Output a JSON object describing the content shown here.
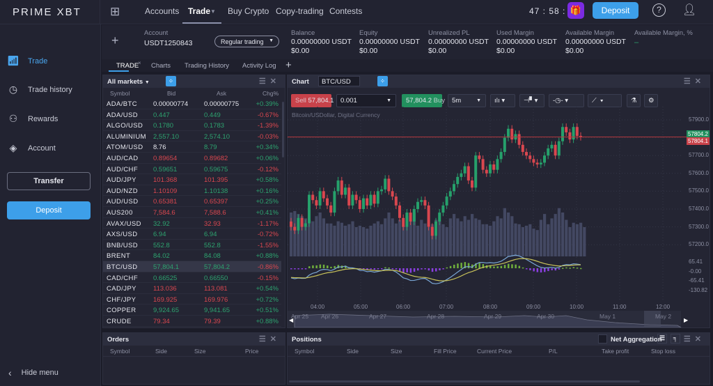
{
  "header": {
    "logo": "PRIME XBT",
    "nav": [
      "Accounts",
      "Trade",
      "Buy Crypto",
      "Copy-trading",
      "Contests"
    ],
    "timer": "47 : 58 : 47",
    "deposit": "Deposit"
  },
  "sidebar": {
    "items": [
      {
        "label": "Trade",
        "icon": "bar-chart-icon"
      },
      {
        "label": "Trade history",
        "icon": "clock-icon"
      },
      {
        "label": "Rewards",
        "icon": "people-icon"
      },
      {
        "label": "Account",
        "icon": "layers-icon"
      }
    ],
    "transfer": "Transfer",
    "deposit": "Deposit",
    "hide_menu": "Hide menu"
  },
  "account": {
    "label": "Account",
    "id": "USDT1250843",
    "mode": "Regular trading",
    "stats": [
      {
        "label": "Balance",
        "usdt": "0.00000000 USDT",
        "usd": "$0.00"
      },
      {
        "label": "Equity",
        "usdt": "0.00000000 USDT",
        "usd": "$0.00"
      },
      {
        "label": "Unrealized PL",
        "usdt": "0.00000000 USDT",
        "usd": "$0.00"
      },
      {
        "label": "Used Margin",
        "usdt": "0.00000000 USDT",
        "usd": "$0.00"
      },
      {
        "label": "Available Margin",
        "usdt": "0.00000000 USDT",
        "usd": "$0.00"
      }
    ],
    "avail_pct_label": "Available Margin, %",
    "avail_pct": "–"
  },
  "tabs": [
    "TRADE",
    "Charts",
    "Trading History",
    "Activity Log"
  ],
  "markets": {
    "title": "All markets",
    "columns": [
      "Symbol",
      "Bid",
      "Ask",
      "Chg%"
    ],
    "selected": "BTC/USD",
    "rows": [
      [
        "ADA/BTC",
        "0.00000774",
        "0.00000775",
        "+0.39%",
        "wh",
        "wh"
      ],
      [
        "ADA/USD",
        "0.447",
        "0.449",
        "-0.67%",
        "up",
        "up"
      ],
      [
        "ALGO/USD",
        "0.1780",
        "0.1783",
        "-1.39%",
        "up",
        "up"
      ],
      [
        "ALUMINIUM",
        "2,557.10",
        "2,574.10",
        "-0.03%",
        "up",
        "up"
      ],
      [
        "ATOM/USD",
        "8.76",
        "8.79",
        "+0.34%",
        "wh",
        "up"
      ],
      [
        "AUD/CAD",
        "0.89654",
        "0.89682",
        "+0.06%",
        "dn",
        "dn"
      ],
      [
        "AUD/CHF",
        "0.59651",
        "0.59675",
        "-0.12%",
        "up",
        "up"
      ],
      [
        "AUD/JPY",
        "101.368",
        "101.395",
        "+0.58%",
        "dn",
        "dn"
      ],
      [
        "AUD/NZD",
        "1.10109",
        "1.10138",
        "+0.16%",
        "dn",
        "up"
      ],
      [
        "AUD/USD",
        "0.65381",
        "0.65397",
        "+0.25%",
        "dn",
        "dn"
      ],
      [
        "AUS200",
        "7,584.6",
        "7,588.6",
        "+0.41%",
        "dn",
        "dn"
      ],
      [
        "AVAX/USD",
        "32.92",
        "32.93",
        "-1.17%",
        "up",
        "dn"
      ],
      [
        "AXS/USD",
        "6.94",
        "6.94",
        "-0.72%",
        "up",
        "up"
      ],
      [
        "BNB/USD",
        "552.8",
        "552.8",
        "-1.55%",
        "up",
        "up"
      ],
      [
        "BRENT",
        "84.02",
        "84.08",
        "+0.88%",
        "up",
        "up"
      ],
      [
        "BTC/USD",
        "57,804.1",
        "57,804.2",
        "-0.86%",
        "up",
        "up"
      ],
      [
        "CAD/CHF",
        "0.66525",
        "0.66550",
        "-0.15%",
        "up",
        "up"
      ],
      [
        "CAD/JPY",
        "113.036",
        "113.081",
        "+0.54%",
        "dn",
        "dn"
      ],
      [
        "CHF/JPY",
        "169.925",
        "169.976",
        "+0.72%",
        "dn",
        "dn"
      ],
      [
        "COPPER",
        "9,924.65",
        "9,941.65",
        "+0.51%",
        "up",
        "up"
      ],
      [
        "CRUDE",
        "79.34",
        "79.39",
        "+0.88%",
        "dn",
        "dn"
      ]
    ]
  },
  "chart": {
    "title": "Chart",
    "symbol": "BTC/USD",
    "sell_label": "Sell",
    "sell_price": "57,804.1",
    "qty": "0.001",
    "buy_price": "57,804.2",
    "buy_label": "Buy",
    "interval": "5m",
    "description": "Bitcoin/USDollar, Digital Currency",
    "colors": {
      "up": "#26a06b",
      "down": "#d9474f",
      "volume": "#434862",
      "macd": "#7aa7d6",
      "signal": "#c9c35a"
    },
    "chart_data": {
      "type": "candlestick",
      "ylim": [
        57150,
        57950
      ],
      "y_ticks": [
        "57900.0",
        "57800.0",
        "57700.0",
        "57600.0",
        "57500.0",
        "57400.0",
        "57300.0",
        "57200.0"
      ],
      "macd_ticks": [
        "65.41",
        "-0.00",
        "-65.41",
        "-130.82"
      ],
      "x_ticks": [
        "04:00",
        "05:00",
        "06:00",
        "07:00",
        "08:00",
        "09:00",
        "10:00",
        "11:00",
        "12:00"
      ],
      "bid": "57804.2",
      "ask": "57804.1",
      "closes": [
        57330,
        57300,
        57280,
        57350,
        57300,
        57320,
        57480,
        57450,
        57420,
        57500,
        57460,
        57420,
        57380,
        57500,
        57560,
        57480,
        57520,
        57420,
        57480,
        57450,
        57400,
        57460,
        57420,
        57480,
        57430,
        57500,
        57510,
        57570,
        57500,
        57470,
        57420,
        57350,
        57300,
        57380,
        57330,
        57400,
        57440,
        57450,
        57420,
        57300,
        57250,
        57330,
        57380,
        57420,
        57470,
        57500,
        57540,
        57580,
        57600,
        57640,
        57560,
        57520,
        57700,
        57680,
        57620,
        57600,
        57650,
        57620,
        57680,
        57720,
        57800,
        57850,
        57790,
        57820,
        57760,
        57720,
        57700,
        57680,
        57660,
        57650,
        57660,
        57700,
        57740,
        57760,
        57700,
        57780,
        57860,
        57830,
        57790,
        57860,
        57810,
        57804
      ],
      "volumes": [
        60,
        62,
        58,
        55,
        52,
        50,
        48,
        55,
        60,
        52,
        45,
        45,
        42,
        48,
        46,
        42,
        44,
        48,
        40,
        42,
        40,
        38,
        42,
        45,
        48,
        44,
        52,
        60,
        52,
        45,
        50,
        42,
        55,
        48,
        60,
        42,
        50,
        45,
        40,
        44,
        50,
        48,
        44,
        40,
        52,
        58,
        52,
        48,
        55,
        50,
        58,
        52,
        50,
        44,
        44,
        42,
        48,
        55,
        52,
        66,
        60,
        55,
        45,
        44,
        40,
        42,
        44,
        38,
        36,
        50,
        58,
        44,
        52,
        58,
        66,
        60,
        50,
        40,
        46,
        44,
        46,
        40
      ]
    },
    "navigator": [
      "Apr 25",
      "Apr 26",
      "Apr 27",
      "Apr 28",
      "Apr 29",
      "Apr 30",
      "May 1",
      "May 2"
    ]
  },
  "orders": {
    "title": "Orders",
    "columns": [
      "Symbol",
      "Side",
      "Size",
      "Price"
    ]
  },
  "positions": {
    "title": "Positions",
    "net_agg": "Net Aggregation",
    "columns": [
      "Symbol",
      "Side",
      "Size",
      "Fill Price",
      "Current Price",
      "P/L",
      "Take profit",
      "Stop loss"
    ]
  }
}
